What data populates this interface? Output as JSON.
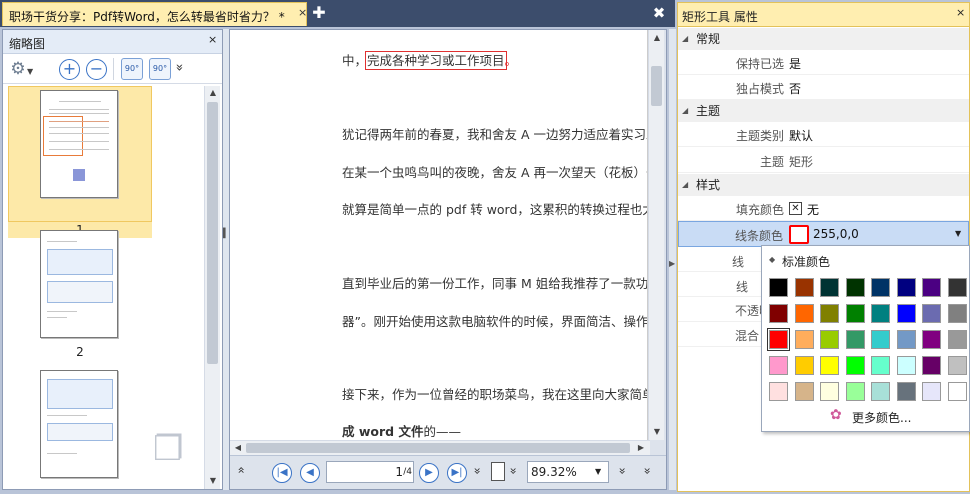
{
  "tab": {
    "title": "职场干货分享：Pdf转Word，怎么转最省时省力？ *",
    "close": "×",
    "add": "✚",
    "bar_close": "✖"
  },
  "thumbs": {
    "title": "缩略图",
    "close": "×",
    "rotate_ccw": "90°",
    "rotate_cw": "90°",
    "more": "»",
    "pages": [
      "1",
      "2"
    ]
  },
  "document": {
    "lines": [
      {
        "pre": "中，",
        "hl": "完成各种学习或工作项目",
        "post": "。",
        "bold": false
      },
      {
        "pre": "犹记得两年前的春夏，我和舍友 A 一边努力适应着实习工",
        "hl": "",
        "post": "",
        "bold": false
      },
      {
        "pre": "在某一个虫鸣鸟叫的夜晚，舍友 A 再一次望天（花板）长叹",
        "hl": "",
        "post": "",
        "bold": false
      },
      {
        "pre": "就算是简单一点的 pdf 转 word，这累积的转换过程也太",
        "hl": "",
        "post": "",
        "bold": false
      },
      {
        "pre": "直到毕业后的第一份工作，同事 M 姐给我推荐了一款功能",
        "hl": "",
        "post": "",
        "bold": false
      },
      {
        "pre": "器”。刚开始使用这款电脑软件的时候，界面简洁、操作",
        "hl": "",
        "post": "",
        "bold": false
      },
      {
        "pre": "接下来，作为一位曾经的职场菜鸟，我在这里向大家简单",
        "hl": "",
        "post": "",
        "bold": false
      },
      {
        "pre": "成 word 文件",
        "hl": "",
        "post": "的——",
        "bold": true
      }
    ],
    "current_page": "1",
    "page_total": "/4",
    "zoom": "89.32%"
  },
  "props": {
    "title": "矩形工具 属性",
    "close": "×",
    "categories": {
      "general": "常规",
      "theme": "主题",
      "style": "样式"
    },
    "rows": {
      "keep_selected_label": "保持已选",
      "keep_selected_value": "是",
      "exclusive_label": "独占模式",
      "exclusive_value": "否",
      "theme_type_label": "主题类别",
      "theme_type_value": "默认",
      "theme_label": "主题",
      "theme_value": "矩形",
      "fill_label": "填充颜色",
      "fill_value": "无",
      "line_color_label": "线条颜色",
      "line_color_value": "255,0,0",
      "opacity_cut": "不透明",
      "blend_cut": "混合",
      "line_width_cut": "线",
      "line_style_cut": "线"
    },
    "line_color": "#ff0000"
  },
  "color_popup": {
    "title": "标准颜色",
    "more": "更多颜色...",
    "colors": [
      [
        "#000000",
        "#993300",
        "#003333",
        "#003300",
        "#003366",
        "#000080",
        "#4b0082",
        "#333333"
      ],
      [
        "#800000",
        "#ff6600",
        "#808000",
        "#008000",
        "#008080",
        "#0000ff",
        "#6b6bb0",
        "#808080"
      ],
      [
        "#ff0000",
        "#ffad5c",
        "#99cc00",
        "#339966",
        "#33cccc",
        "#7399c6",
        "#800080",
        "#999999"
      ],
      [
        "#ff99cc",
        "#ffcc00",
        "#ffff00",
        "#00ff00",
        "#66ffcc",
        "#ccffff",
        "#660066",
        "#c0c0c0"
      ],
      [
        "#ffe0e0",
        "#d6b48a",
        "#ffffe0",
        "#99ff99",
        "#a8e0d8",
        "#67727c",
        "#e6e6fa",
        "#ffffff"
      ]
    ]
  }
}
